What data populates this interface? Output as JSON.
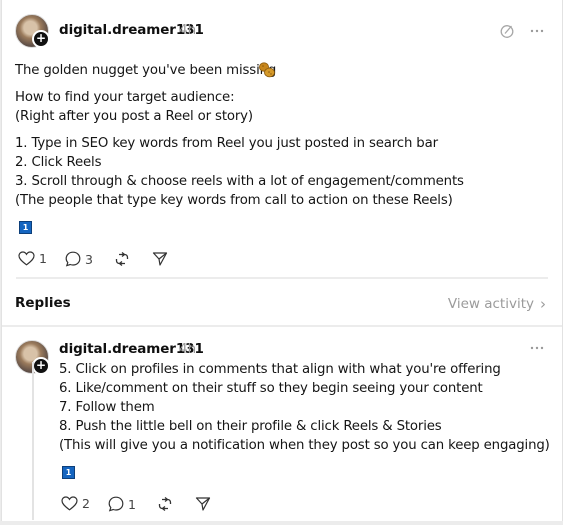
{
  "post": {
    "author": "digital.dreamer131",
    "time": "4h",
    "title_line": "The golden nugget you've been missing",
    "title_emoji": "peanut-emoji",
    "lines": [
      "How to find your target audience:",
      "(Right after you post a Reel or story)",
      "1. Type in SEO key words from Reel you just posted in search bar",
      "2. Click Reels",
      "3. Scroll through & choose reels with a lot of engagement/comments",
      "(The people that type key words from call to action on these Reels)"
    ],
    "continuation_emoji": "1",
    "likes": "1",
    "comments": "3",
    "icons": {
      "like": "heart-icon",
      "comment": "speech-bubble-icon",
      "repost": "repost-icon",
      "share": "send-icon",
      "edit": "edit-icon",
      "more": "more-icon"
    }
  },
  "replies_section": {
    "label": "Replies",
    "view_activity": "View activity",
    "chevron": "›"
  },
  "reply": {
    "author": "digital.dreamer131",
    "time": "4h",
    "lines": [
      "5. Click on profiles in comments that align with what you're offering",
      "6. Like/comment on their stuff so they begin seeing your content",
      "7. Follow them",
      "8. Push the little bell on their profile & click Reels & Stories",
      "(This will give you a notification when they post so you can keep engaging)"
    ],
    "continuation_emoji": "1",
    "likes": "2",
    "comments": "1"
  },
  "colors": {
    "keycap": "#1565c0",
    "muted_text": "#9a9a9a",
    "divider": "#ececec"
  }
}
